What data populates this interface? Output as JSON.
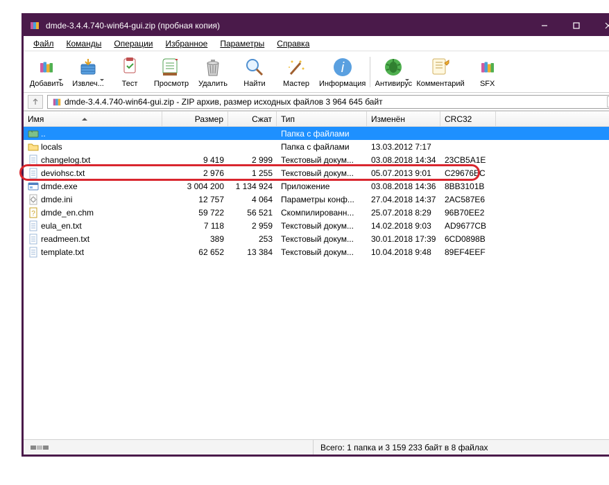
{
  "window": {
    "title": "dmde-3.4.4.740-win64-gui.zip (пробная копия)"
  },
  "menus": [
    "Файл",
    "Команды",
    "Операции",
    "Избранное",
    "Параметры",
    "Справка"
  ],
  "tools": [
    {
      "name": "add",
      "label": "Добавить",
      "drop": true
    },
    {
      "name": "extract",
      "label": "Извлеч...",
      "drop": true
    },
    {
      "name": "test",
      "label": "Тест"
    },
    {
      "name": "view",
      "label": "Просмотр"
    },
    {
      "name": "delete",
      "label": "Удалить"
    },
    {
      "name": "find",
      "label": "Найти"
    },
    {
      "name": "wizard",
      "label": "Мастер"
    },
    {
      "name": "info",
      "label": "Информация"
    },
    {
      "name": "antivirus",
      "label": "Антивирус",
      "drop": true
    },
    {
      "name": "comment",
      "label": "Комментарий"
    },
    {
      "name": "sfx",
      "label": "SFX"
    }
  ],
  "pathbar": {
    "text": "dmde-3.4.4.740-win64-gui.zip - ZIP архив, размер исходных файлов 3 964 645 байт"
  },
  "columns": {
    "name": "Имя",
    "size": "Размер",
    "packed": "Сжат",
    "type": "Тип",
    "date": "Изменён",
    "crc": "CRC32"
  },
  "rows": [
    {
      "icon": "folder-up",
      "name": "..",
      "type": "Папка с файлами",
      "selected": true
    },
    {
      "icon": "folder",
      "name": "locals",
      "type": "Папка с файлами",
      "date": "13.03.2012 7:17"
    },
    {
      "icon": "text",
      "name": "changelog.txt",
      "size": "9 419",
      "packed": "2 999",
      "type": "Текстовый докум...",
      "date": "03.08.2018 14:34",
      "crc": "23CB5A1E"
    },
    {
      "icon": "text",
      "name": "deviohsc.txt",
      "size": "2 976",
      "packed": "1 255",
      "type": "Текстовый докум...",
      "date": "05.07.2013 9:01",
      "crc": "C29676EC"
    },
    {
      "icon": "exe",
      "name": "dmde.exe",
      "size": "3 004 200",
      "packed": "1 134 924",
      "type": "Приложение",
      "date": "03.08.2018 14:36",
      "crc": "8BB3101B",
      "highlight": true
    },
    {
      "icon": "ini",
      "name": "dmde.ini",
      "size": "12 757",
      "packed": "4 064",
      "type": "Параметры конф...",
      "date": "27.04.2018 14:37",
      "crc": "2AC587E6"
    },
    {
      "icon": "chm",
      "name": "dmde_en.chm",
      "size": "59 722",
      "packed": "56 521",
      "type": "Скомпилированн...",
      "date": "25.07.2018 8:29",
      "crc": "96B70EE2"
    },
    {
      "icon": "text",
      "name": "eula_en.txt",
      "size": "7 118",
      "packed": "2 959",
      "type": "Текстовый докум...",
      "date": "14.02.2018 9:03",
      "crc": "AD9677CB"
    },
    {
      "icon": "text",
      "name": "readmeen.txt",
      "size": "389",
      "packed": "253",
      "type": "Текстовый докум...",
      "date": "30.01.2018 17:39",
      "crc": "6CD0898B"
    },
    {
      "icon": "text",
      "name": "template.txt",
      "size": "62 652",
      "packed": "13 384",
      "type": "Текстовый докум...",
      "date": "10.04.2018 9:48",
      "crc": "89EF4EEF"
    }
  ],
  "status": {
    "right": "Всего: 1 папка и 3 159 233 байт в 8 файлах"
  }
}
